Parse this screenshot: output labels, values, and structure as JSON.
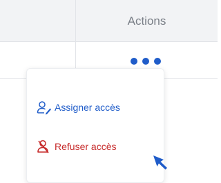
{
  "table": {
    "header": {
      "actions_label": "Actions"
    }
  },
  "row_actions": {
    "more_icon": "more-horizontal-icon"
  },
  "menu": {
    "items": [
      {
        "label": "Assigner accès",
        "icon": "assign-user-icon",
        "color": "#1f5cc9"
      },
      {
        "label": "Refuser accès",
        "icon": "refuse-user-icon",
        "color": "#c62828"
      }
    ]
  },
  "colors": {
    "accent": "#1f5cc9",
    "danger": "#c62828",
    "header_bg": "#f2f3f5",
    "header_text": "#7a7f87"
  }
}
